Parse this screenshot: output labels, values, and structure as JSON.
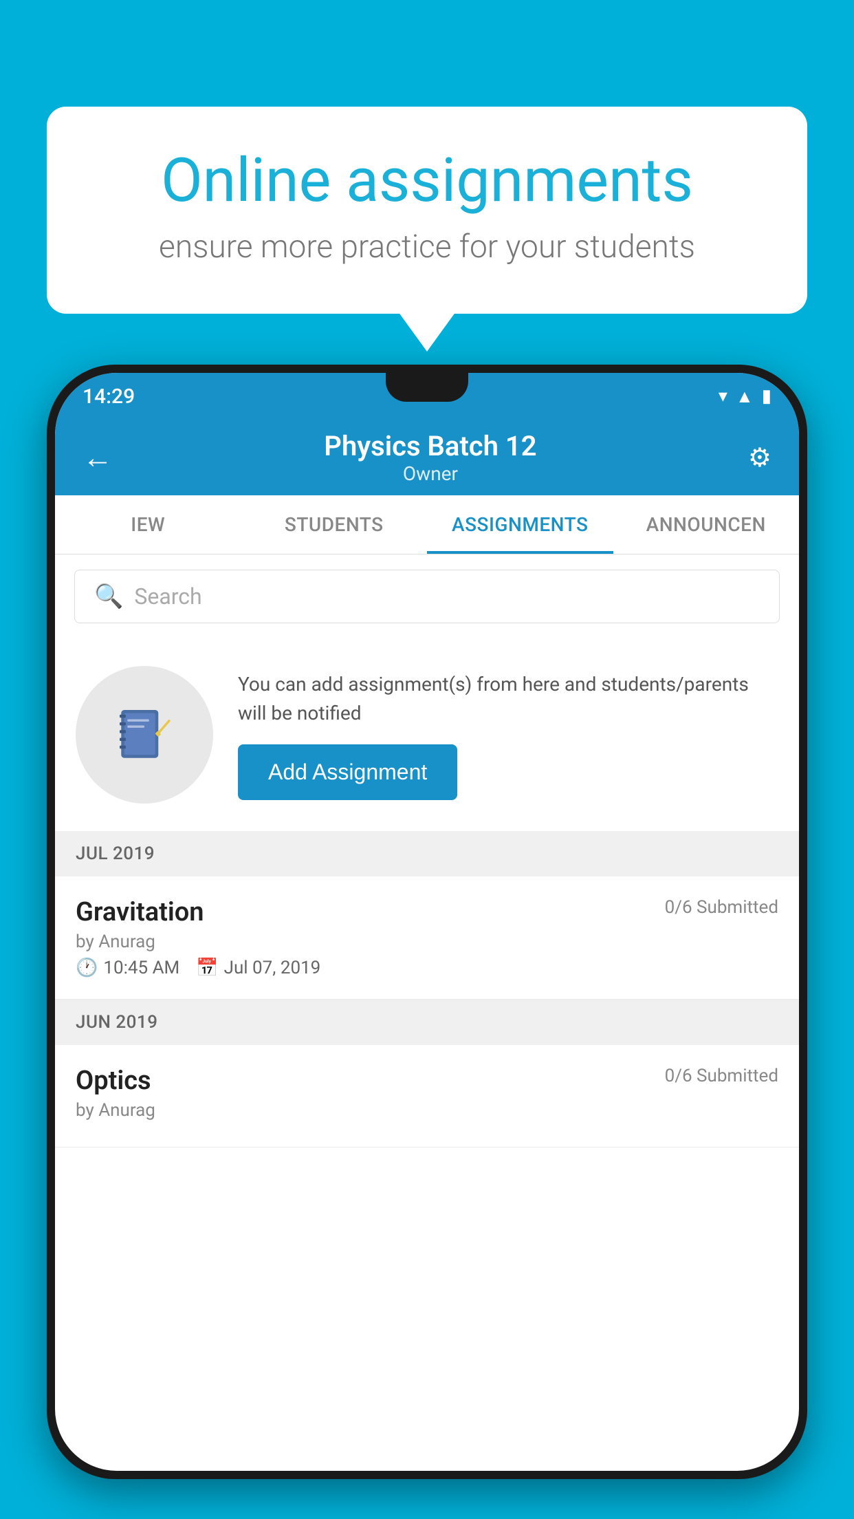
{
  "background_color": "#00b0d8",
  "speech_bubble": {
    "title": "Online assignments",
    "subtitle": "ensure more practice for your students"
  },
  "phone": {
    "status_bar": {
      "time": "14:29",
      "icons": [
        "wifi",
        "signal",
        "battery"
      ]
    },
    "header": {
      "title": "Physics Batch 12",
      "subtitle": "Owner",
      "back_label": "←",
      "settings_label": "⚙"
    },
    "tabs": [
      {
        "label": "IEW",
        "active": false
      },
      {
        "label": "STUDENTS",
        "active": false
      },
      {
        "label": "ASSIGNMENTS",
        "active": true
      },
      {
        "label": "ANNOUNCEMENTS",
        "active": false
      }
    ],
    "search": {
      "placeholder": "Search"
    },
    "promo": {
      "description": "You can add assignment(s) from here and students/parents will be notified",
      "button_label": "Add Assignment"
    },
    "sections": [
      {
        "header": "JUL 2019",
        "assignments": [
          {
            "title": "Gravitation",
            "submitted": "0/6 Submitted",
            "by": "by Anurag",
            "time": "10:45 AM",
            "date": "Jul 07, 2019"
          }
        ]
      },
      {
        "header": "JUN 2019",
        "assignments": [
          {
            "title": "Optics",
            "submitted": "0/6 Submitted",
            "by": "by Anurag",
            "time": "",
            "date": ""
          }
        ]
      }
    ]
  }
}
